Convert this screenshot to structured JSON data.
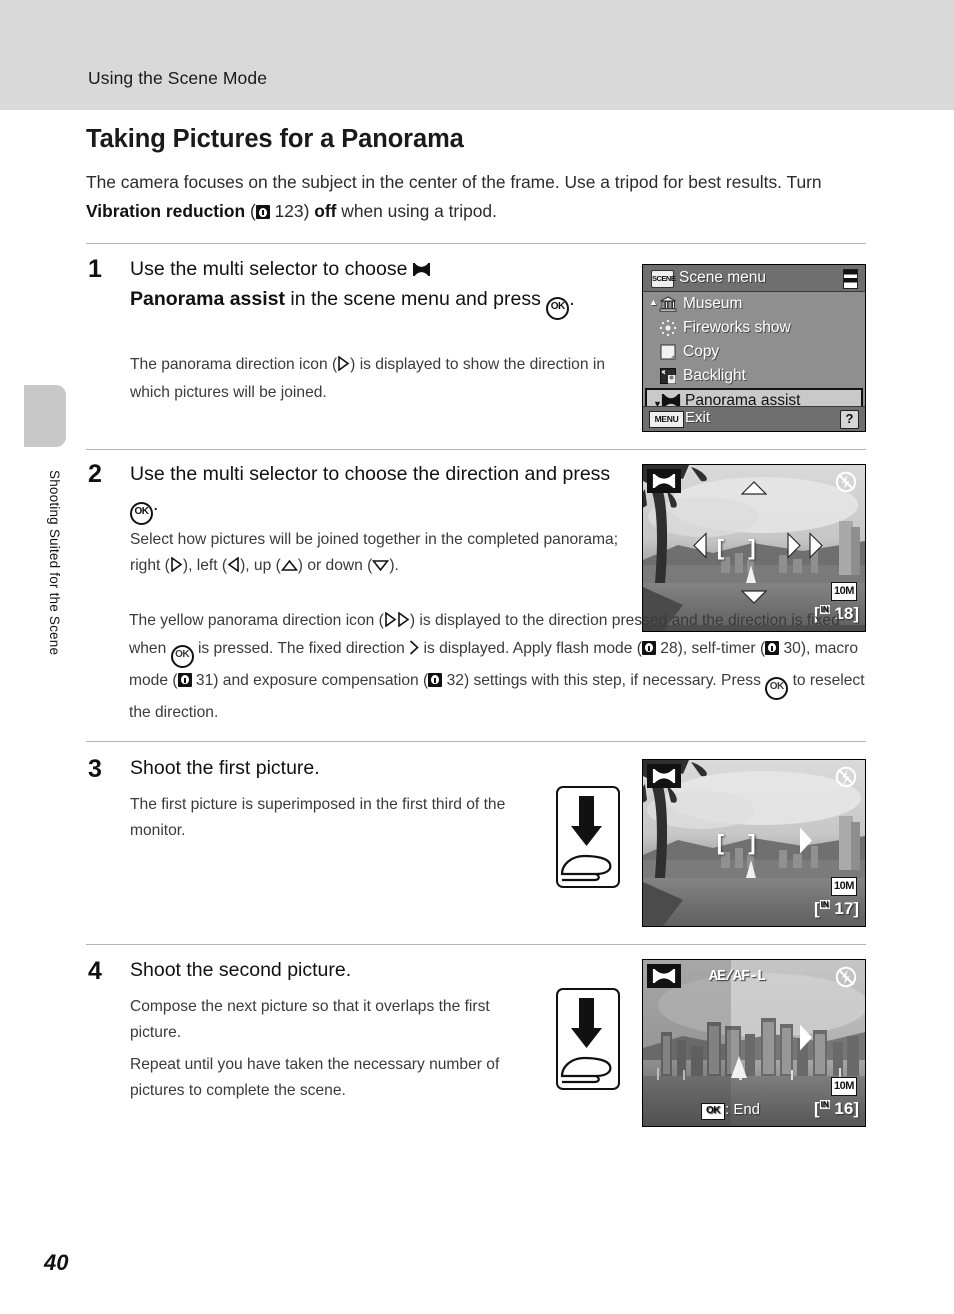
{
  "header": {
    "running_head": "Using the Scene Mode"
  },
  "sidebar": {
    "chapter_label": "Shooting Suited for the Scene"
  },
  "page": {
    "number": "40"
  },
  "title": "Taking Pictures for a Panorama",
  "intro": {
    "part1": "The camera focuses on the subject in the center of the frame. Use a tripod for best results. Turn ",
    "bold1": "Vibration reduction",
    "part2": " (",
    "ref1": "123",
    "part3": ") ",
    "bold2": "off",
    "part4": " when using a tripod."
  },
  "steps": [
    {
      "number": "1",
      "heading_pre": "Use the multi selector to choose ",
      "heading_bold": "Panorama assist",
      "heading_post": " in the scene menu and press ",
      "heading_end": ".",
      "body": [
        {
          "pre": "The panorama direction icon (",
          "post": ") is displayed to show the direction in which pictures will be joined."
        }
      ]
    },
    {
      "number": "2",
      "heading_pre": "Use the multi selector to choose the direction and press ",
      "heading_end": ".",
      "body_a_pre": "Select how pictures will be joined together in the completed panorama; right (",
      "body_a_mid1": "), left (",
      "body_a_mid2": "), up (",
      "body_a_mid3": ") or down (",
      "body_a_end": ").",
      "wide": {
        "s1": "The yellow panorama direction icon (",
        "s2": ") is displayed to the direction pressed and the direction is fixed when ",
        "s3": " is pressed. The fixed direction ",
        "s4": " is displayed. Apply flash mode (",
        "ref_flash": "28",
        "s5": "), self-timer (",
        "ref_timer": "30",
        "s6": "), macro mode (",
        "ref_macro": "31",
        "s7": ") and exposure compensation (",
        "ref_exp": "32",
        "s8": ") settings with this step, if necessary. Press ",
        "s9": " to reselect the direction."
      }
    },
    {
      "number": "3",
      "heading": "Shoot the first picture.",
      "body": "The first picture is superimposed in the first third of the monitor."
    },
    {
      "number": "4",
      "heading": "Shoot the second picture.",
      "body1": "Compose the next picture so that it overlaps the first picture.",
      "body2": "Repeat until you have taken the necessary number of pictures to complete the scene."
    }
  ],
  "scene_menu": {
    "title": "Scene menu",
    "badge": "SCENE",
    "items": [
      {
        "label": "Museum",
        "icon": "museum-icon",
        "selected": false
      },
      {
        "label": "Fireworks show",
        "icon": "fireworks-icon",
        "selected": false
      },
      {
        "label": "Copy",
        "icon": "copy-icon",
        "selected": false
      },
      {
        "label": "Backlight",
        "icon": "backlight-icon",
        "selected": false
      },
      {
        "label": "Panorama assist",
        "icon": "panorama-icon",
        "selected": true
      }
    ],
    "footer": {
      "menu_badge": "MENU",
      "exit_label": "Exit",
      "help": "?"
    }
  },
  "monitor_step2": {
    "image_size": "10M",
    "frames_remaining": "18",
    "storage": "IN",
    "focus_brackets": "[  ]",
    "arrows": [
      "up",
      "left",
      "right-outline",
      "right-solid",
      "down"
    ],
    "flash_icon": "flash-off-icon",
    "panorama_icon": "panorama-icon"
  },
  "monitor_step3": {
    "image_size": "10M",
    "frames_remaining": "17",
    "storage": "IN",
    "focus_brackets": "[  ]",
    "flash_icon": "flash-off-icon",
    "panorama_icon": "panorama-icon"
  },
  "monitor_step4": {
    "ae_af_lock": "AE/AF-L",
    "image_size": "10M",
    "frames_remaining": "16",
    "storage": "IN",
    "end_label": ": End",
    "ok_chip": "OK",
    "flash_icon": "flash-off-icon",
    "panorama_icon": "panorama-icon"
  },
  "colors": {
    "header_band": "#d9d9d9",
    "side_tab": "#c8c8c8",
    "divider": "#b4b4b4",
    "menu_bg": "#8f8f8f",
    "menu_bar": "#6f6f6f",
    "selection": "#c9c9c9"
  }
}
